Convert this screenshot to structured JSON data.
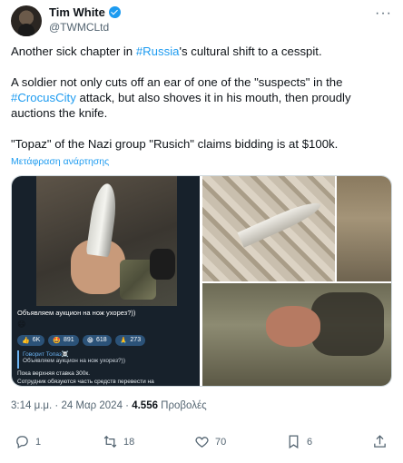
{
  "author": {
    "display_name": "Tim White",
    "handle": "@TWMCLtd",
    "verified_icon": "verified-badge-icon"
  },
  "tweet": {
    "p1_pre": "Another sick chapter in ",
    "p1_link": "#Russia",
    "p1_post": "'s cultural shift to a cesspit.",
    "p2_pre": "A soldier not only cuts off an ear of one of the \"suspects\" in the ",
    "p2_link": "#CrocusCity",
    "p2_post": " attack, but also shoves it in his mouth, then proudly auctions the knife.",
    "p3": "\"Topaz\" of the Nazi group \"Rusich\" claims bidding is at $100k."
  },
  "translate_label": "Μετάφραση ανάρτησης",
  "telegram": {
    "message": "Объявляем аукцион на нож ухорез?))",
    "emoji": "😄",
    "reactions": [
      {
        "emoji": "👍",
        "count": "6K"
      },
      {
        "emoji": "🤩",
        "count": "891"
      },
      {
        "emoji": "😁",
        "count": "618"
      },
      {
        "emoji": "🙏",
        "count": "273"
      }
    ],
    "quote_author": "Говорит Топаз☠️",
    "quote_text": "Объявляем аукцион на нож ухорез?))",
    "line1": "Пока верхняя ставка 300к.",
    "line2": "Сотрудник обязуются часть средств перевести на"
  },
  "meta": {
    "time": "3:14 μ.μ. · 24 Μαρ 2024 · ",
    "views": "4.556",
    "views_label": " Προβολές"
  },
  "actions": {
    "reply_count": "1",
    "retweet_count": "18",
    "like_count": "70",
    "bookmark_count": "6"
  },
  "colors": {
    "accent": "#1d9bf0",
    "text": "#0f1419",
    "secondary": "#536471"
  }
}
